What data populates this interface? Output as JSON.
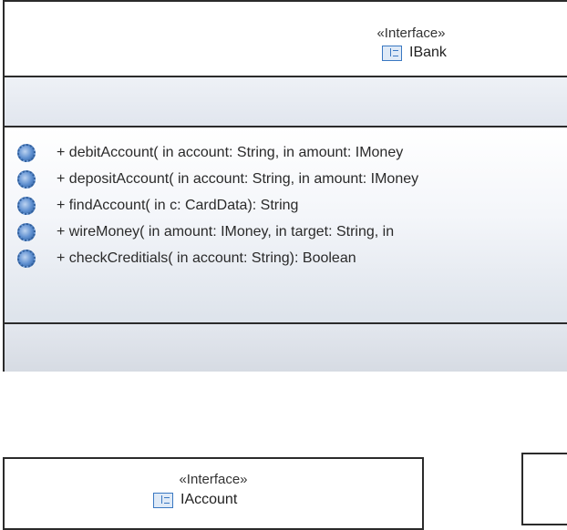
{
  "ibank": {
    "stereotype": "«Interface»",
    "name": "IBank",
    "operations": [
      "+ debitAccount(  in account: String,   in amount: IMoney",
      "+ depositAccount(  in account: String,   in amount: IMoney",
      "+ findAccount(  in c: CardData): String",
      "+ wireMoney(  in amount: IMoney,   in target: String,   in",
      "+ checkCreditials(  in account: String): Boolean"
    ]
  },
  "iaccount": {
    "stereotype": "«Interface»",
    "name": "IAccount"
  }
}
